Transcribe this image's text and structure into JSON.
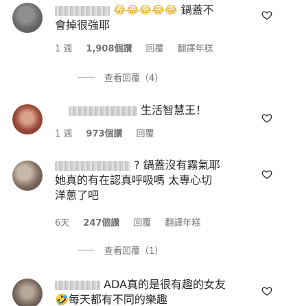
{
  "comments": [
    {
      "emojis": "😂😂😂😂😂",
      "text_line1": "鍋蓋不",
      "text_line2": "會掉很強耶",
      "time": "1 週",
      "likes": "1,908個讚",
      "reply": "回覆",
      "translate": "翻譯年糕"
    },
    {
      "text_line1": "生活智慧王！",
      "time": "1 週",
      "likes": "973個讚",
      "reply": "回覆"
    },
    {
      "text_line1": "? 鍋蓋沒有霧氣耶",
      "text_line2": "她真的有在認真呼吸嗎 太專心切",
      "text_line3": "洋蔥了吧",
      "time": "6天",
      "likes": "247個讚",
      "reply": "回覆",
      "translate": "翻譯年糕"
    },
    {
      "text_line1": "ADA真的是很有趣的女友",
      "emoji2": "🤣",
      "text_line2": "每天都有不同的樂趣"
    }
  ],
  "view_replies": [
    {
      "label": "查看回覆（4）"
    },
    {
      "label": "查看回覆（1）"
    }
  ]
}
